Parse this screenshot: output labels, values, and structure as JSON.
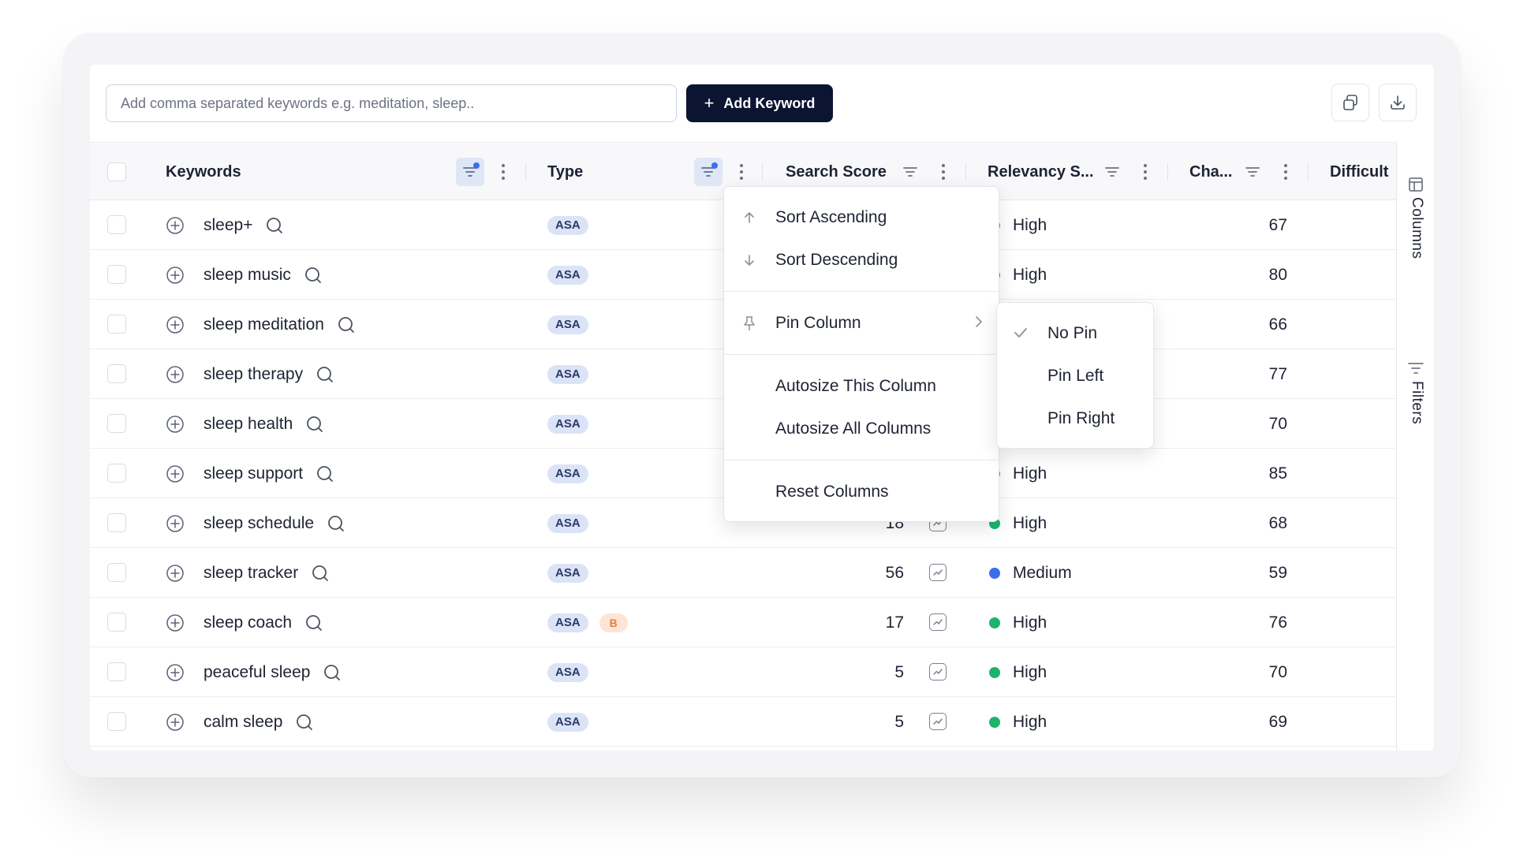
{
  "toolbar": {
    "keyword_placeholder": "Add comma separated keywords e.g. meditation, sleep..",
    "add_keyword_label": "Add Keyword",
    "copy_icon": "copy-icon",
    "download_icon": "download-icon"
  },
  "columns": {
    "keywords": "Keywords",
    "type": "Type",
    "search_score": "Search Score",
    "relevancy": "Relevancy S...",
    "chance": "Cha...",
    "difficulty": "Difficult"
  },
  "rows": [
    {
      "keyword": "sleep+",
      "type": "ASA",
      "extra_badge": "",
      "search_score": "",
      "relevancy": "High",
      "relevancy_color": "#1db36b",
      "chance": "67"
    },
    {
      "keyword": "sleep music",
      "type": "ASA",
      "extra_badge": "",
      "search_score": "",
      "relevancy": "High",
      "relevancy_color": "#1db36b",
      "chance": "80"
    },
    {
      "keyword": "sleep meditation",
      "type": "ASA",
      "extra_badge": "",
      "search_score": "",
      "relevancy": "",
      "relevancy_color": "#1db36b",
      "chance": "66"
    },
    {
      "keyword": "sleep therapy",
      "type": "ASA",
      "extra_badge": "",
      "search_score": "",
      "relevancy": "",
      "relevancy_color": "#1db36b",
      "chance": "77"
    },
    {
      "keyword": "sleep health",
      "type": "ASA",
      "extra_badge": "",
      "search_score": "",
      "relevancy": "",
      "relevancy_color": "#1db36b",
      "chance": "70"
    },
    {
      "keyword": "sleep support",
      "type": "ASA",
      "extra_badge": "",
      "search_score": "",
      "relevancy": "High",
      "relevancy_color": "#1db36b",
      "chance": "85"
    },
    {
      "keyword": "sleep schedule",
      "type": "ASA",
      "extra_badge": "",
      "search_score": "18",
      "relevancy": "High",
      "relevancy_color": "#1db36b",
      "chance": "68"
    },
    {
      "keyword": "sleep tracker",
      "type": "ASA",
      "extra_badge": "",
      "search_score": "56",
      "relevancy": "Medium",
      "relevancy_color": "#3b6ee8",
      "chance": "59"
    },
    {
      "keyword": "sleep coach",
      "type": "ASA",
      "extra_badge": "B",
      "search_score": "17",
      "relevancy": "High",
      "relevancy_color": "#1db36b",
      "chance": "76"
    },
    {
      "keyword": "peaceful sleep",
      "type": "ASA",
      "extra_badge": "",
      "search_score": "5",
      "relevancy": "High",
      "relevancy_color": "#1db36b",
      "chance": "70"
    },
    {
      "keyword": "calm sleep",
      "type": "ASA",
      "extra_badge": "",
      "search_score": "5",
      "relevancy": "High",
      "relevancy_color": "#1db36b",
      "chance": "69"
    }
  ],
  "column_menu": {
    "sort_ascending": "Sort Ascending",
    "sort_descending": "Sort Descending",
    "pin_column": "Pin Column",
    "autosize_this": "Autosize This Column",
    "autosize_all": "Autosize All Columns",
    "reset_columns": "Reset Columns"
  },
  "pin_submenu": {
    "no_pin": "No Pin",
    "pin_left": "Pin Left",
    "pin_right": "Pin Right",
    "selected": "No Pin"
  },
  "side_panel": {
    "columns": "Columns",
    "filters": "Filters"
  },
  "colors": {
    "primary_button": "#0b1431",
    "badge_bg": "#dbe3f7",
    "high": "#1db36b",
    "medium": "#3b6ee8"
  }
}
